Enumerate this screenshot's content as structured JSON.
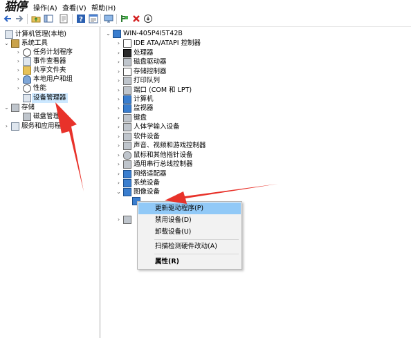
{
  "menubar": {
    "title_mark": "猫停",
    "items": [
      {
        "label": "操作(A)"
      },
      {
        "label": "查看(V)"
      },
      {
        "label": "帮助(H)"
      }
    ]
  },
  "left_tree": {
    "root": "计算机管理(本地)",
    "system_tools": "系统工具",
    "task_scheduler": "任务计划程序",
    "event_viewer": "事件查看器",
    "shared_folders": "共享文件夹",
    "local_users": "本地用户和组",
    "performance": "性能",
    "device_manager": "设备管理器",
    "storage": "存储",
    "disk_management": "磁盘管理",
    "services": "服务和应用程序"
  },
  "device_tree": {
    "computer": "WIN-405P4I5T42B",
    "categories": [
      "IDE ATA/ATAPI 控制器",
      "处理器",
      "磁盘驱动器",
      "存储控制器",
      "打印队列",
      "端口 (COM 和 LPT)",
      "计算机",
      "监视器",
      "键盘",
      "人体学输入设备",
      "软件设备",
      "声音、视频和游戏控制器",
      "鼠标和其他指针设备",
      "通用串行总线控制器",
      "网络适配器",
      "系统设备",
      "图像设备"
    ]
  },
  "context_menu": {
    "update_driver": "更新驱动程序(P)",
    "disable_device": "禁用设备(D)",
    "uninstall_device": "卸载设备(U)",
    "scan_hardware": "扫描检测硬件改动(A)",
    "properties": "属性(R)"
  },
  "colors": {
    "selection": "#cce8ff",
    "menu_highlight": "#91c9f7",
    "annotation_arrow": "#e8322a"
  }
}
